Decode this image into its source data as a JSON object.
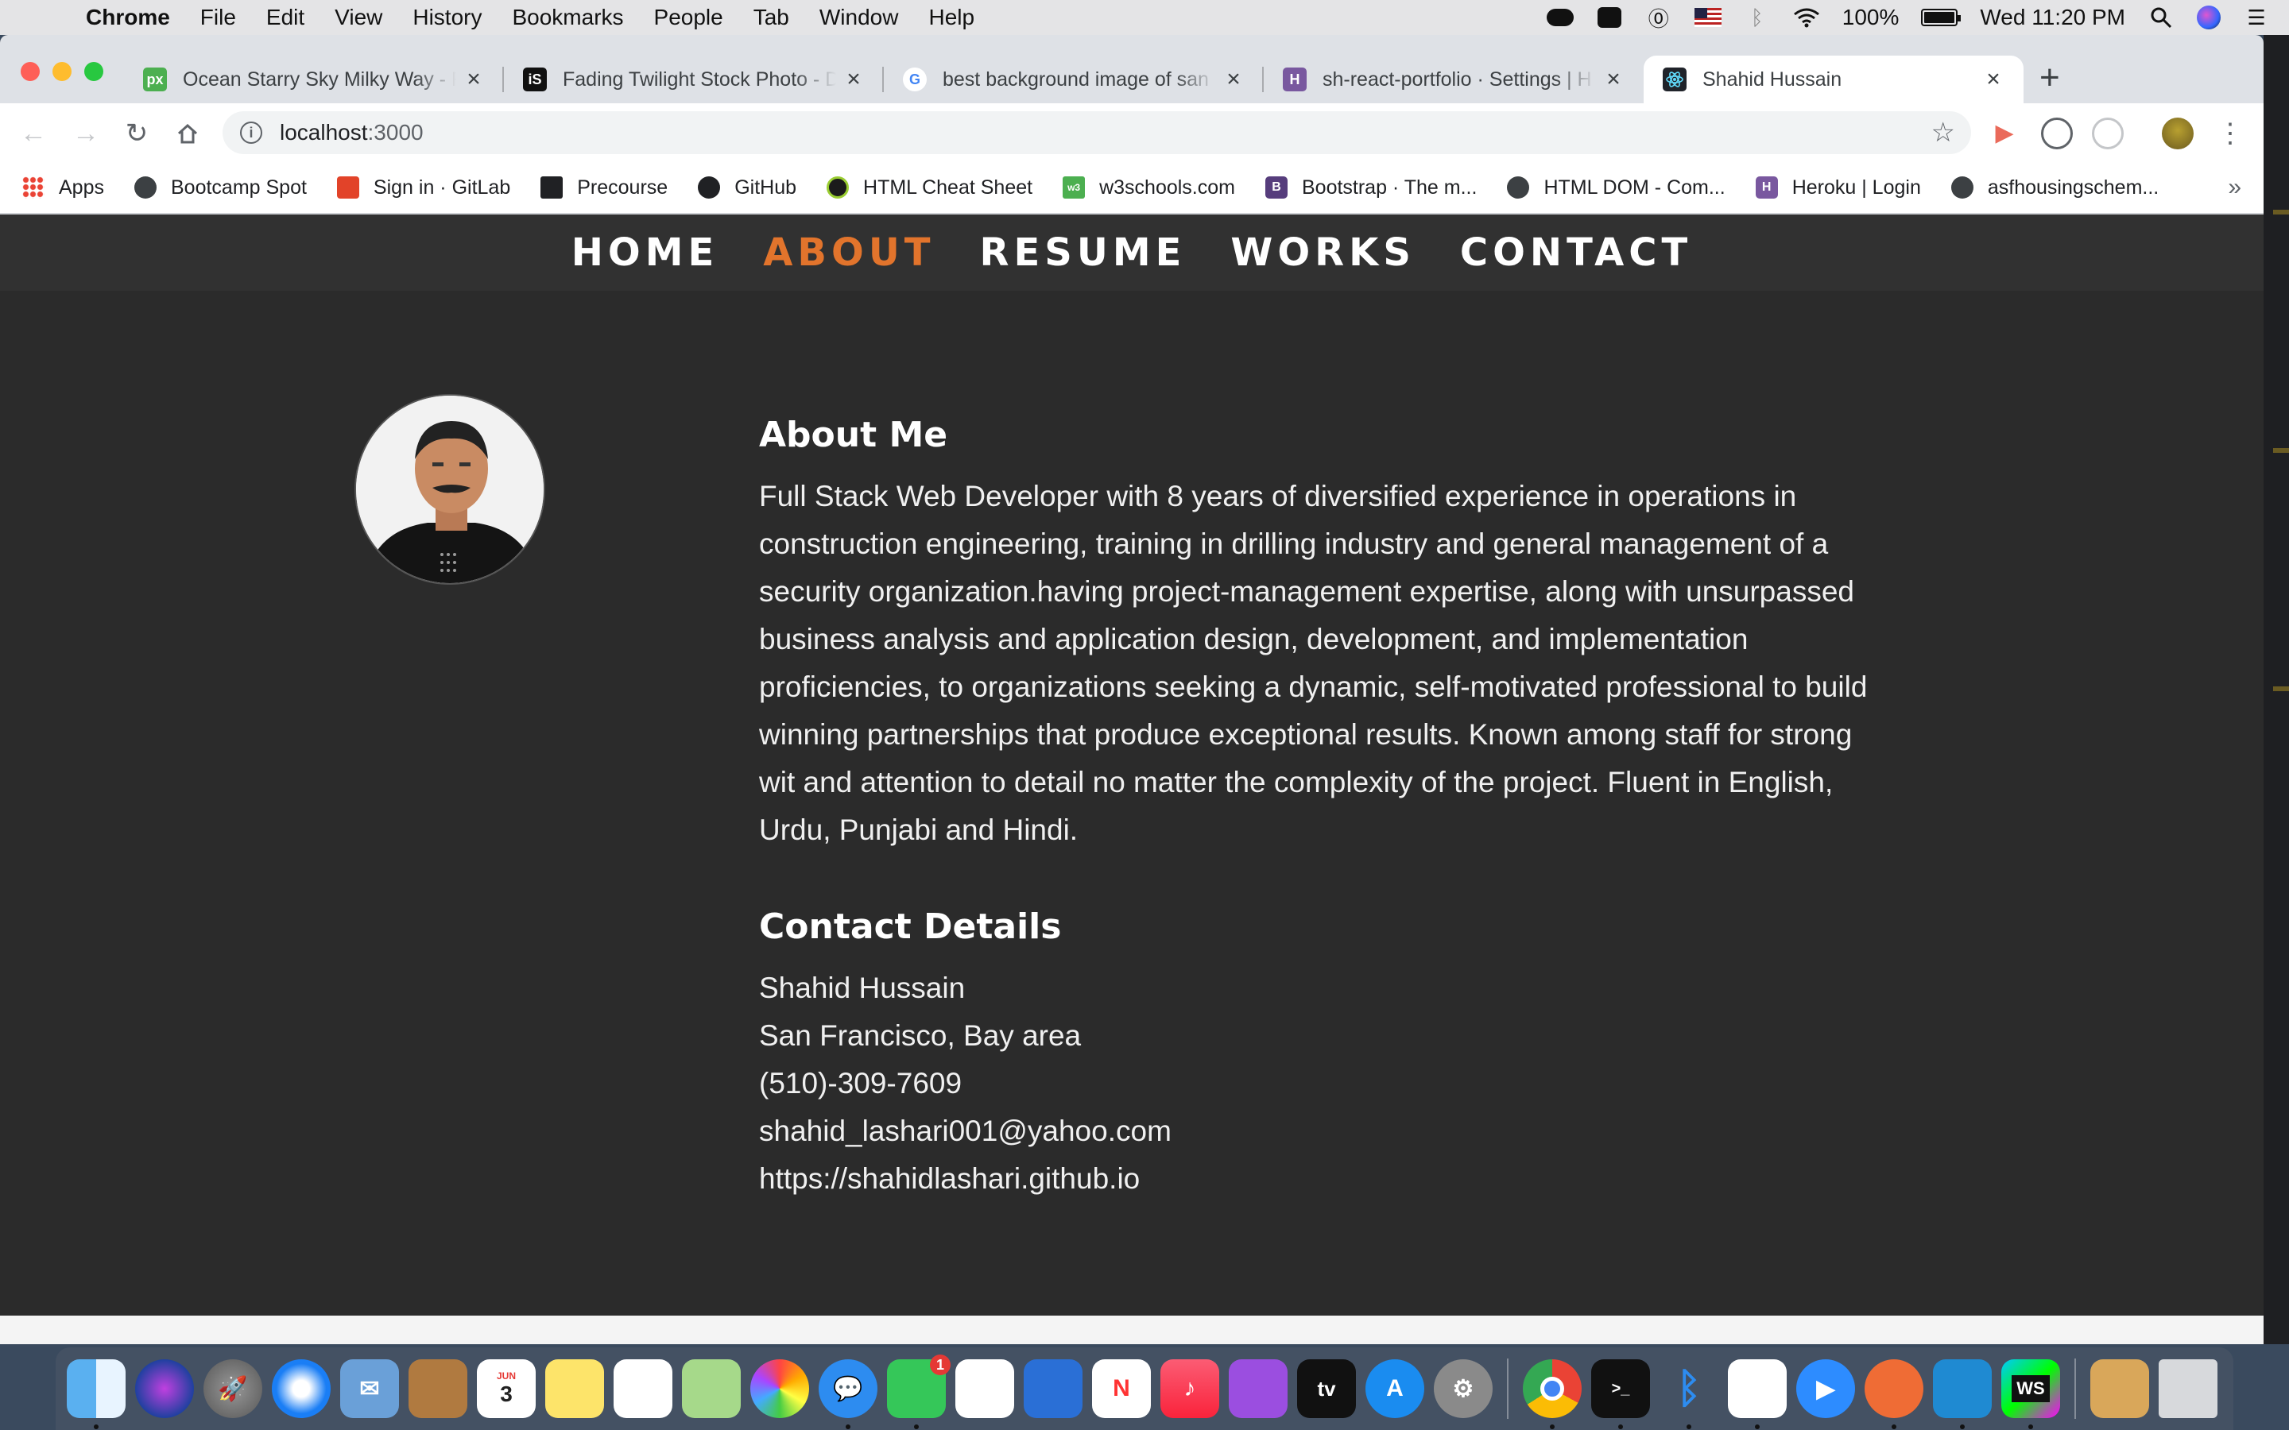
{
  "menubar": {
    "app_name": "Chrome",
    "items": [
      "File",
      "Edit",
      "View",
      "History",
      "Bookmarks",
      "People",
      "Tab",
      "Window",
      "Help"
    ],
    "battery_percent": "100%",
    "battery_level": 1.0,
    "clock": "Wed 11:20 PM"
  },
  "tabs": [
    {
      "title": "Ocean Starry Sky Milky Way - F",
      "favicon": "px",
      "favicon_color": "#4caf50"
    },
    {
      "title": "Fading Twilight Stock Photo - D",
      "favicon": "iS",
      "favicon_color": "#111111"
    },
    {
      "title": "best background image of san",
      "favicon": "G",
      "favicon_color": "#4285f4"
    },
    {
      "title": "sh-react-portfolio · Settings | H",
      "favicon": "H",
      "favicon_color": "#79589f"
    },
    {
      "title": "Shahid Hussain",
      "favicon": "react",
      "favicon_color": "#61dafb"
    }
  ],
  "address_bar": {
    "host": "localhost",
    "port": ":3000"
  },
  "bookmarks": [
    {
      "label": "Apps",
      "icon": "apps-grid-icon"
    },
    {
      "label": "Bootcamp Spot",
      "icon": "globe-icon"
    },
    {
      "label": "Sign in · GitLab",
      "icon": "gitlab-icon"
    },
    {
      "label": "Precourse",
      "icon": "book-icon"
    },
    {
      "label": "GitHub",
      "icon": "github-icon"
    },
    {
      "label": "HTML Cheat Sheet",
      "icon": "cheatsheet-icon"
    },
    {
      "label": "w3schools.com",
      "icon": "w3schools-icon"
    },
    {
      "label": "Bootstrap · The m...",
      "icon": "bootstrap-icon"
    },
    {
      "label": "HTML DOM - Com...",
      "icon": "globe-icon"
    },
    {
      "label": "Heroku | Login",
      "icon": "heroku-icon"
    },
    {
      "label": "asfhousingschem...",
      "icon": "globe-icon"
    }
  ],
  "site_nav": {
    "items": [
      "HOME",
      "ABOUT",
      "RESUME",
      "WORKS",
      "CONTACT"
    ],
    "active": "ABOUT",
    "accent_color": "#e2742c"
  },
  "about": {
    "heading": "About Me",
    "bio": "Full Stack Web Developer with 8 years of diversified experience in operations in construction engineering, training in drilling industry and general management of a security organization.having project-management expertise, along with unsurpassed business analysis and application design, development, and implementation proficiencies, to organizations seeking a dynamic, self-motivated professional to build winning partnerships that produce exceptional results. Known among staff for strong wit and attention to detail no matter the complexity of the project. Fluent in English, Urdu, Punjabi and Hindi."
  },
  "contact": {
    "heading": "Contact Details",
    "name": "Shahid Hussain",
    "location": "San Francisco, Bay area",
    "phone": "(510)-309-7609",
    "email": "shahid_lashari001@yahoo.com",
    "website": "https://shahidlashari.github.io"
  },
  "dock": {
    "calendar_month": "JUN",
    "calendar_day": "3",
    "facetime_badge": "1",
    "appletv_label": "tv"
  }
}
